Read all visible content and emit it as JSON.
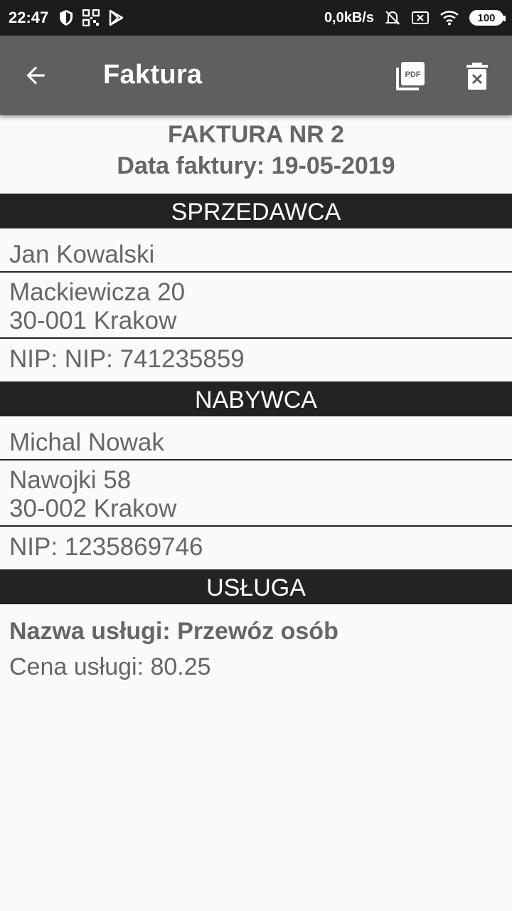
{
  "status_bar": {
    "time": "22:47",
    "speed": "0,0kB/s",
    "battery": "100"
  },
  "app_bar": {
    "title": "Faktura"
  },
  "invoice": {
    "number": "FAKTURA NR 2",
    "date": "Data faktury: 19-05-2019"
  },
  "seller": {
    "header": "SPRZEDAWCA",
    "name": "Jan Kowalski",
    "address_line1": "Mackiewicza 20",
    "address_line2": "30-001 Krakow",
    "nip": "NIP: NIP: 741235859"
  },
  "buyer": {
    "header": "NABYWCA",
    "name": "Michal Nowak",
    "address_line1": "Nawojki 58",
    "address_line2": "30-002 Krakow",
    "nip": "NIP: 1235869746"
  },
  "service": {
    "header": "USŁUGA",
    "name": "Nazwa usługi: Przewóz osób",
    "price": "Cena usługi: 80.25"
  },
  "icons": {
    "back": "arrow-back-icon",
    "pdf": "pdf-icon",
    "delete": "delete-icon"
  },
  "colors": {
    "status_bar": "#1c1c1c",
    "app_bar": "#5f5f5f",
    "section_header": "#232323",
    "text": "#666666",
    "background": "#fafafa"
  }
}
